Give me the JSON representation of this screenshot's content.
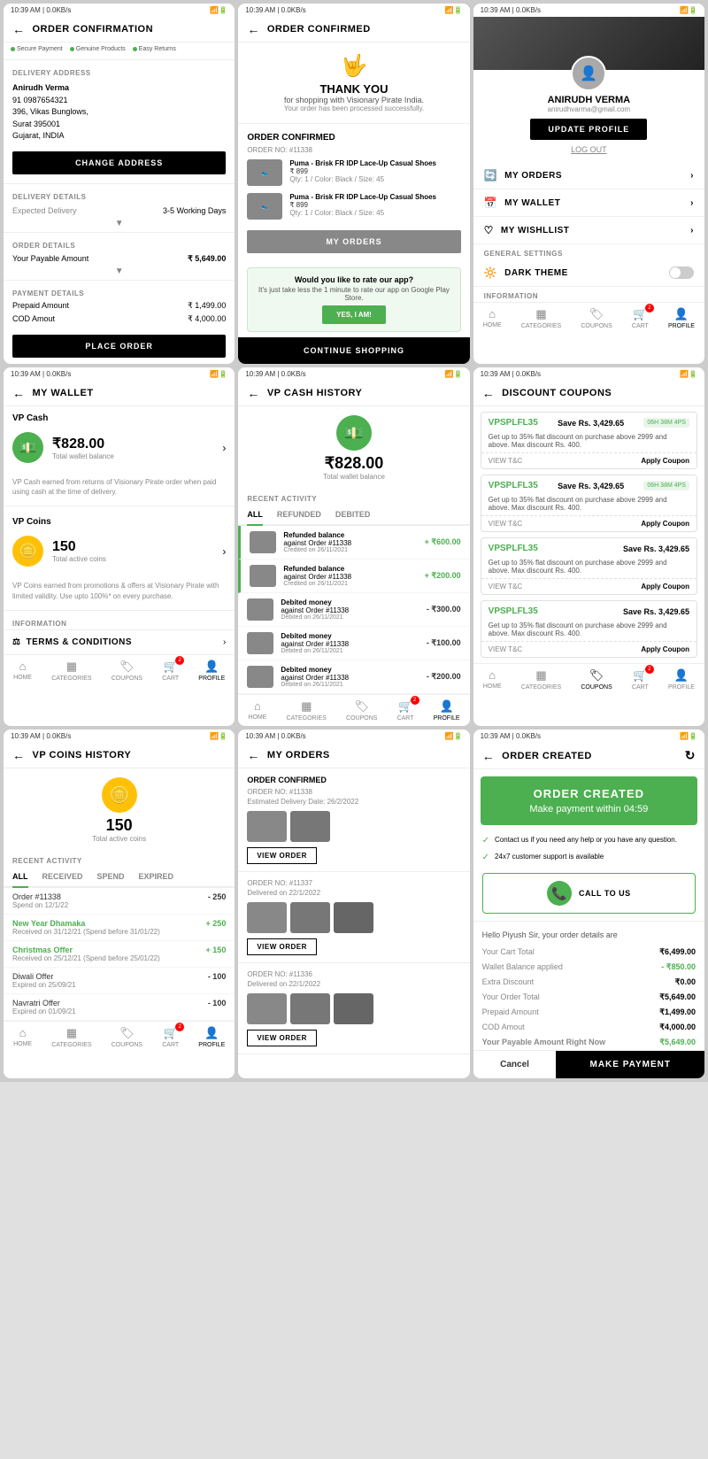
{
  "screens": [
    {
      "id": "order-confirmation",
      "statusBar": "10:39 AM | 0.0KB/s",
      "title": "ORDER CONFIRMATION",
      "badges": [
        "Secure Payment",
        "Genuine Products",
        "Easy Returns"
      ],
      "sections": {
        "deliveryAddress": {
          "label": "DELIVERY ADDRESS",
          "name": "Anirudh Verma",
          "phone": "91 0987654321",
          "address": "396, Vikas Bunglows,\nSurat 395001\nGujarat, INDIA",
          "changeBtn": "CHANGE ADDRESS"
        },
        "deliveryDetails": {
          "label": "DELIVERY DETAILS",
          "expectedLabel": "Expected Delivery",
          "expectedValue": "3-5 Working Days"
        },
        "orderDetails": {
          "label": "ORDER DETAILS",
          "payableLabel": "Your Payable Amount",
          "payableValue": "₹ 5,649.00"
        },
        "paymentDetails": {
          "label": "PAYMENT DETAILS",
          "prepaidLabel": "Prepaid Amount",
          "prepaidValue": "₹ 1,499.00",
          "codLabel": "COD Amout",
          "codValue": "₹ 4,000.00"
        }
      },
      "placeOrderBtn": "PLACE ORDER"
    },
    {
      "id": "order-confirmed",
      "statusBar": "10:39 AM | 0.0KB/s",
      "title": "ORDER CONFIRMED",
      "thankYou": {
        "icon": "🤟",
        "title": "THANK YOU",
        "sub": "for shopping with Visionary Pirate India.",
        "note": "Your order has been processed successfully."
      },
      "orderConfirmed": {
        "label": "ORDER CONFIRMED",
        "orderNo": "ORDER NO: #11338",
        "products": [
          {
            "name": "Puma - Brisk FR IDP Lace-Up Casual Shoes",
            "price": "₹ 899",
            "meta": "Qty: 1 / Color: Black / Size: 45"
          },
          {
            "name": "Puma - Brisk FR IDP Lace-Up Casual Shoes",
            "price": "₹ 899",
            "meta": "Qty: 1 / Color: Black / Size: 45"
          }
        ],
        "myOrdersBtn": "MY ORDERS"
      },
      "rateApp": {
        "title": "Would you like to rate our app?",
        "sub": "It's just take less the 1 minute to rate our app on Google Play Store.",
        "btn": "YES, I AM!"
      },
      "continueBtn": "CONTINUE SHOPPING"
    },
    {
      "id": "profile",
      "statusBar": "10:39 AM | 0.0KB/s",
      "user": {
        "name": "ANIRUDH VERMA",
        "email": "anirudhvarma@gmail.com",
        "updateBtn": "UPDATE PROFILE",
        "logoutLink": "LOG OUT"
      },
      "menuItems": [
        {
          "icon": "📦",
          "label": "MY ORDERS"
        },
        {
          "icon": "💳",
          "label": "MY WALLET"
        },
        {
          "icon": "♡",
          "label": "MY WISHLLIST"
        }
      ],
      "generalSettings": {
        "label": "GENERAL SETTINGS",
        "darkTheme": "DARK THEME"
      },
      "information": "INFORMATION",
      "navItems": [
        "HOME",
        "CATEGORIES",
        "COUPONS",
        "CART",
        "PROFILE"
      ],
      "activeNav": "PROFILE"
    },
    {
      "id": "my-wallet",
      "statusBar": "10:39 AM | 0.0KB/s",
      "title": "MY WALLET",
      "cash": {
        "title": "VP Cash",
        "icon": "💵",
        "amount": "₹828.00",
        "label": "Total wallet balance",
        "desc": "VP Cash earned from returns of Visionary Pirate order when paid using cash at the time of delivery."
      },
      "coins": {
        "title": "VP Coins",
        "icon": "🪙",
        "amount": "150",
        "label": "Total active coins",
        "desc": "VP Coins earned from promotions & offers at Visionary Pirate with limited validity. Use upto 100%* on every purchase."
      },
      "information": {
        "label": "INFORMATION",
        "termsLabel": "TERMS & CONDITIONS"
      },
      "navItems": [
        "HOME",
        "CATEGORIES",
        "COUPONS",
        "CART",
        "PROFILE"
      ],
      "activeNav": "PROFILE"
    },
    {
      "id": "vp-cash-history",
      "statusBar": "10:39 AM | 0.0KB/s",
      "title": "VP CASH HISTORY",
      "balance": {
        "icon": "💵",
        "amount": "₹828.00",
        "label": "Total wallet balance"
      },
      "recentActivity": "RECENT ACTIVITY",
      "tabs": [
        "ALL",
        "REFUNDED",
        "DEBITED"
      ],
      "activeTab": "ALL",
      "activities": [
        {
          "name": "Refunded balance",
          "sub": "against Order #11338",
          "date": "Credited on 26/11/2021",
          "amount": "+ ₹600.00",
          "type": "pos"
        },
        {
          "name": "Refunded balance",
          "sub": "against Order #11338",
          "date": "Credited on 26/11/2021",
          "amount": "+ ₹200.00",
          "type": "pos"
        },
        {
          "name": "Debited money",
          "sub": "against Order #11338",
          "date": "Debited on 26/11/2021",
          "amount": "- ₹300.00",
          "type": "neg"
        },
        {
          "name": "Debited money",
          "sub": "against Order #11338",
          "date": "Debited on 26/11/2021",
          "amount": "- ₹100.00",
          "type": "neg"
        },
        {
          "name": "Debited money",
          "sub": "against Order #11338",
          "date": "Debited on 26/11/2021",
          "amount": "- ₹200.00",
          "type": "neg"
        }
      ],
      "navItems": [
        "HOME",
        "CATEGORIES",
        "COUPONS",
        "CART",
        "PROFILE"
      ],
      "activeNav": "PROFILE"
    },
    {
      "id": "discount-coupons",
      "statusBar": "10:39 AM | 0.0KB/s",
      "title": "DISCOUNT COUPONS",
      "coupons": [
        {
          "code": "VPSPLFL35",
          "save": "Save Rs. 3,429.65",
          "timer": "06H 38M 4PS",
          "desc": "Get up to 35% flat discount on purchase above 2999 and above. Max discount Rs. 400.",
          "viewTC": "VIEW T&C",
          "apply": "Apply Coupon"
        },
        {
          "code": "VPSPLFL35",
          "save": "Save Rs. 3,429.65",
          "timer": "06H 38M 4PS",
          "desc": "Get up to 35% flat discount on purchase above 2999 and above. Max discount Rs. 400.",
          "viewTC": "VIEW T&C",
          "apply": "Apply Coupon"
        },
        {
          "code": "VPSPLFL35",
          "save": "Save Rs. 3,429.65",
          "timer": "",
          "desc": "Get up to 35% flat discount on purchase above 2999 and above. Max discount Rs. 400.",
          "viewTC": "VIEW T&C",
          "apply": "Apply Coupon"
        },
        {
          "code": "VPSPLFL35",
          "save": "Save Rs. 3,429.65",
          "timer": "",
          "desc": "Get up to 35% flat discount on purchase above 2999 and above. Max discount Rs. 400.",
          "viewTC": "VIEW T&C",
          "apply": "Apply Coupon"
        }
      ],
      "navItems": [
        "HOME",
        "CATEGORIES",
        "COUPONS",
        "CART",
        "PROFILE"
      ],
      "activeNav": "COUPONS"
    },
    {
      "id": "vp-coins-history",
      "statusBar": "10:39 AM | 0.0KB/s",
      "title": "VP COINS HISTORY",
      "balance": {
        "icon": "🪙",
        "amount": "150",
        "label": "Total active coins"
      },
      "recentActivity": "RECENT ACTIVITY",
      "tabs": [
        "ALL",
        "RECEIVED",
        "SPEND",
        "EXPIRED"
      ],
      "activeTab": "ALL",
      "activities": [
        {
          "label": "Order #11338",
          "date": "Spend on 12/1/22",
          "amount": "- 250",
          "type": "neg"
        },
        {
          "label": "New Year Dhamaka",
          "date": "Received on 31/12/21 (Spend before 31/01/22)",
          "amount": "+ 250",
          "type": "pos",
          "green": true
        },
        {
          "label": "Christmas Offer",
          "date": "Received on 25/12/21 (Spend before 25/01/22)",
          "amount": "+ 150",
          "type": "pos",
          "green": true
        },
        {
          "label": "Diwali Offer",
          "date": "Expired on 25/09/21",
          "amount": "- 100",
          "type": "neg"
        },
        {
          "label": "Navratri Offer",
          "date": "Expired on 01/09/21",
          "amount": "- 100",
          "type": "neg"
        }
      ],
      "navItems": [
        "HOME",
        "CATEGORIES",
        "COUPONS",
        "CART",
        "PROFILE"
      ],
      "activeNav": "PROFILE"
    },
    {
      "id": "my-orders",
      "statusBar": "10:39 AM | 0.0KB/s",
      "title": "MY ORDERS",
      "orders": [
        {
          "status": "ORDER CONFIRMED",
          "orderNo": "ORDER NO: #11338",
          "delivery": "Estimated Delivery Date: 26/2/2022",
          "imgCount": 2,
          "viewBtn": "VIEW ORDER"
        },
        {
          "status": "",
          "orderNo": "ORDER NO: #11337",
          "delivery": "Delivered on 22/1/2022",
          "imgCount": 3,
          "viewBtn": "VIEW ORDER"
        },
        {
          "status": "",
          "orderNo": "ORDER NO: #11336",
          "delivery": "Delivered on 22/1/2022",
          "imgCount": 3,
          "viewBtn": "VIEW ORDER"
        }
      ]
    },
    {
      "id": "order-created",
      "statusBar": "10:39 AM | 0.0KB/s",
      "title": "ORDER CREATED",
      "createdBox": {
        "title": "ORDER CREATED",
        "timer": "Make payment within 04:59"
      },
      "infoItems": [
        "Contact us if you need any help or you have any question.",
        "24x7 customer support is available"
      ],
      "callUsBtn": "CALL TO US",
      "greeting": "Hello Piyush Sir, your order details are",
      "details": [
        {
          "label": "Your Cart Total",
          "value": "₹6,499.00",
          "type": "normal"
        },
        {
          "label": "Wallet Balance applied",
          "value": "- ₹850.00",
          "type": "green"
        },
        {
          "label": "Extra Discount",
          "value": "₹0.00",
          "type": "normal"
        },
        {
          "label": "Your Order Total",
          "value": "₹5,649.00",
          "type": "normal"
        },
        {
          "label": "Prepaid Amount",
          "value": "₹1,499.00",
          "type": "normal"
        },
        {
          "label": "COD Amout",
          "value": "₹4,000.00",
          "type": "normal"
        },
        {
          "label": "Your Payable Amount Right Now",
          "value": "₹5,649.00",
          "type": "normal"
        }
      ],
      "cancelBtn": "Cancel",
      "makePaymentBtn": "MAKE PAYMENT"
    }
  ]
}
